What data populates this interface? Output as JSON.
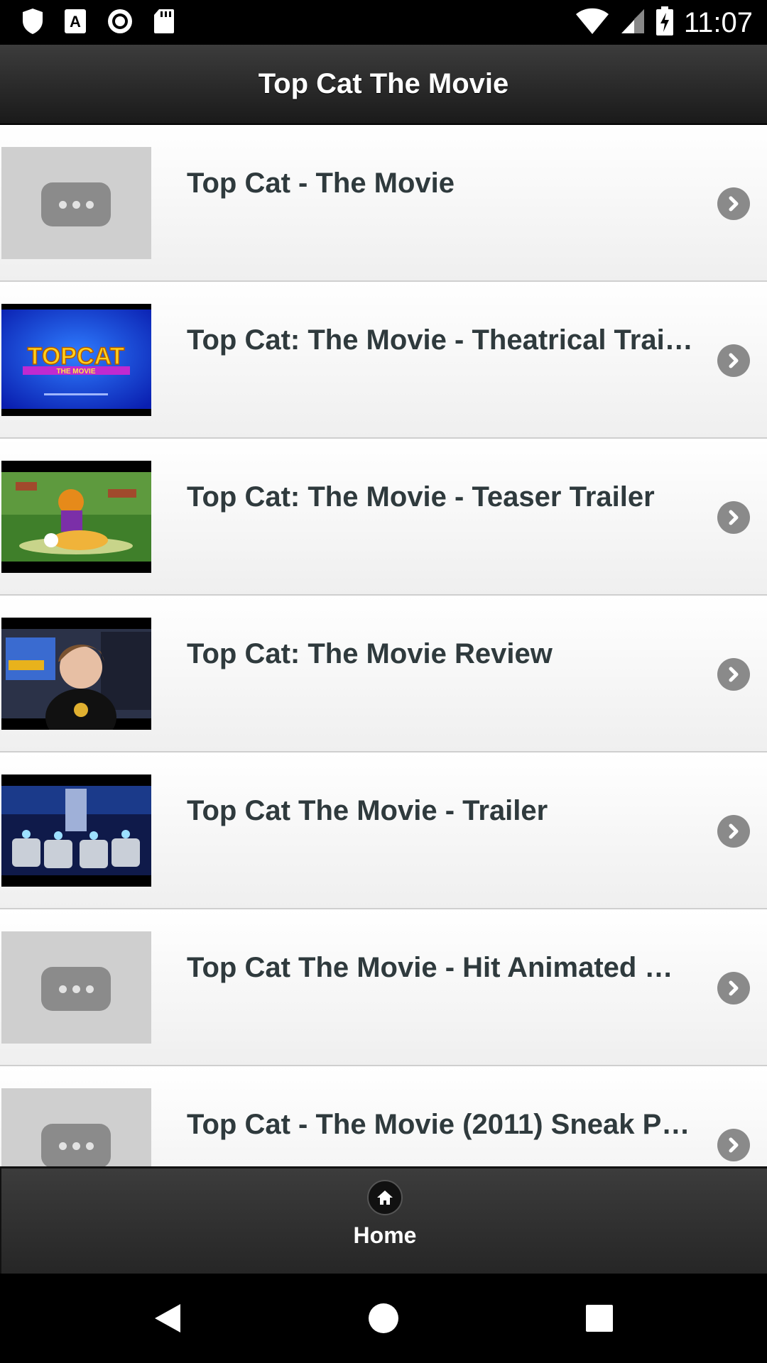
{
  "status_bar": {
    "time": "11:07",
    "left_icons": [
      "shield-icon",
      "a-badge-icon",
      "record-icon",
      "sd-card-icon"
    ],
    "right_icons": [
      "wifi-icon",
      "cell-signal-icon",
      "battery-charging-icon"
    ]
  },
  "header": {
    "title": "Top Cat The Movie"
  },
  "videos": [
    {
      "title": "Top Cat - The Movie",
      "thumbnail": "placeholder"
    },
    {
      "title": "Top Cat: The Movie - Theatrical Trai…",
      "thumbnail": "topcat-logo"
    },
    {
      "title": "Top Cat: The Movie - Teaser Trailer",
      "thumbnail": "cartoon-scene"
    },
    {
      "title": "Top Cat: The Movie Review",
      "thumbnail": "reviewer"
    },
    {
      "title": "Top Cat The Movie - Trailer",
      "thumbnail": "robot-hall"
    },
    {
      "title": "Top Cat The Movie - Hit Animated …",
      "thumbnail": "placeholder"
    },
    {
      "title": "Top Cat - The Movie (2011) Sneak P…",
      "thumbnail": "placeholder"
    }
  ],
  "thumbnail_logo": {
    "line1": "TOPCAT",
    "line2": "THE MOVIE"
  },
  "footer": {
    "home_label": "Home"
  },
  "colors": {
    "header_bg": "#2b2b2b",
    "list_bg": "#f3f3f3",
    "title_text": "#2f3a3d",
    "chevron": "#8a8a8a"
  }
}
